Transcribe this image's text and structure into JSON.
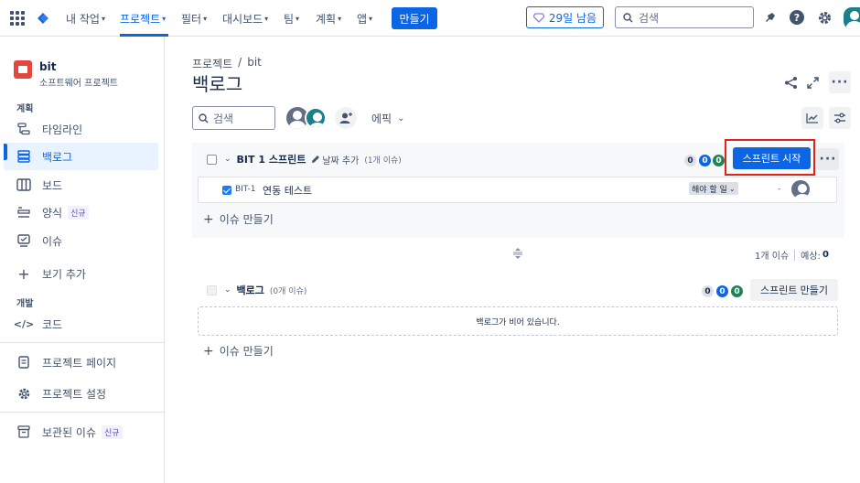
{
  "topnav": {
    "items": [
      {
        "label": "내 작업",
        "has_dropdown": true
      },
      {
        "label": "프로젝트",
        "has_dropdown": true,
        "active": true
      },
      {
        "label": "필터",
        "has_dropdown": true
      },
      {
        "label": "대시보드",
        "has_dropdown": true
      },
      {
        "label": "팀",
        "has_dropdown": true
      },
      {
        "label": "계획",
        "has_dropdown": true
      },
      {
        "label": "앱",
        "has_dropdown": true
      }
    ],
    "create_label": "만들기",
    "trial_label": "29일 남음",
    "search_placeholder": "검색",
    "icons": [
      "app-grid-icon",
      "jira-logo-icon",
      "gem-icon",
      "search-icon",
      "notification-icon",
      "help-icon",
      "settings-icon",
      "profile-avatar"
    ],
    "accent_color": "#0c66e4"
  },
  "sidebar": {
    "project_name": "bit",
    "project_type": "소프트웨어 프로젝트",
    "section_planning": "계획",
    "section_dev": "개발",
    "items": [
      {
        "label": "타임라인",
        "icon": "timeline-icon"
      },
      {
        "label": "백로그",
        "icon": "backlog-icon",
        "active": true
      },
      {
        "label": "보드",
        "icon": "board-icon"
      },
      {
        "label": "양식",
        "icon": "form-icon",
        "badge": "신규"
      },
      {
        "label": "이슈",
        "icon": "issues-icon"
      },
      {
        "label": "보기 추가",
        "icon": "plus-icon"
      },
      {
        "label": "코드",
        "icon": "code-icon"
      },
      {
        "label": "프로젝트 페이지",
        "icon": "page-icon"
      },
      {
        "label": "프로젝트 설정",
        "icon": "gear-icon"
      },
      {
        "label": "보관된 이슈",
        "icon": "archive-icon",
        "badge": "신규"
      }
    ]
  },
  "main": {
    "breadcrumb": [
      "프로젝트",
      "bit"
    ],
    "breadcrumb_sep": "/",
    "title": "백로그",
    "search_placeholder": "검색",
    "epic_label": "에픽",
    "sprint": {
      "name": "BIT 1 스프린트",
      "add_date_label": "날짜 추가",
      "issue_count_label": "(1개 이슈)",
      "counts": {
        "todo": "0",
        "in_progress": "0",
        "done": "0"
      },
      "start_label": "스프린트 시작",
      "issues": [
        {
          "key": "BIT-1",
          "summary": "연동 테스트",
          "status": "해야 할 일",
          "estimate": "-"
        }
      ],
      "create_issue_label": "이슈 만들기"
    },
    "sprint_summary": {
      "issues": "1개 이슈",
      "estimate_label": "예상:",
      "estimate_value": "0"
    },
    "backlog": {
      "name": "백로그",
      "issue_count_label": "(0개 이슈)",
      "counts": {
        "todo": "0",
        "in_progress": "0",
        "done": "0"
      },
      "create_sprint_label": "스프린트 만들기",
      "empty_text": "백로그가 비어 있습니다.",
      "create_issue_label": "이슈 만들기"
    },
    "colors": {
      "highlight": "#e2231a",
      "done": "#1f845a",
      "in_progress": "#0c66e4"
    }
  }
}
